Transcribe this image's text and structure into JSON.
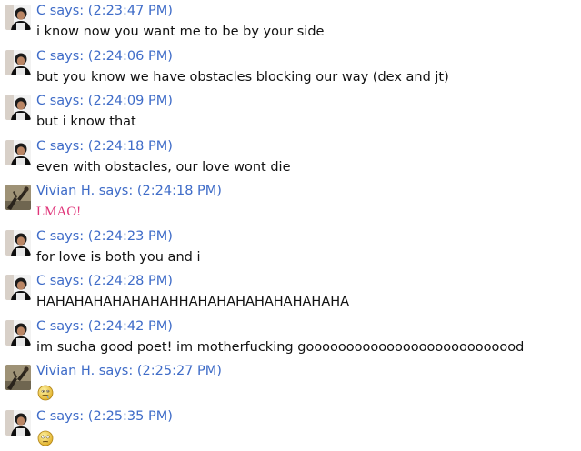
{
  "colors": {
    "sender": "#3f6cc8",
    "text": "#111111",
    "vivian_text": "#e0357a"
  },
  "messages": [
    {
      "sender": "C",
      "header": "C says: (2:23:47 PM)",
      "text": "i know now you want me to be by your side",
      "avatar": "c-avatar",
      "style": "default"
    },
    {
      "sender": "C",
      "header": "C says: (2:24:06 PM)",
      "text": "but you know we have obstacles blocking our way (dex and jt)",
      "avatar": "c-avatar",
      "style": "default"
    },
    {
      "sender": "C",
      "header": "C says: (2:24:09 PM)",
      "text": "but i know that",
      "avatar": "c-avatar",
      "style": "default"
    },
    {
      "sender": "C",
      "header": "C says: (2:24:18 PM)",
      "text": "even with obstacles, our love wont die",
      "avatar": "c-avatar",
      "style": "default"
    },
    {
      "sender": "Vivian H.",
      "header": "Vivian H. says: (2:24:18 PM)",
      "text": "LMAO!",
      "avatar": "vivian-avatar",
      "style": "vivian"
    },
    {
      "sender": "C",
      "header": "C says: (2:24:23 PM)",
      "text": "for love is both you and i",
      "avatar": "c-avatar",
      "style": "default"
    },
    {
      "sender": "C",
      "header": "C says: (2:24:28 PM)",
      "text": "HAHAHAHAHAHAHAHHAHAHAHAHAHAHAHAHA",
      "avatar": "c-avatar",
      "style": "default"
    },
    {
      "sender": "C",
      "header": "C says: (2:24:42 PM)",
      "text": "im sucha good poet! im motherfucking gooooooooooooooooooooooooood",
      "avatar": "c-avatar",
      "style": "default"
    },
    {
      "sender": "Vivian H.",
      "header": "Vivian H. says: (2:25:27 PM)",
      "text": "",
      "emoticon": "drooling-face-emoticon",
      "avatar": "vivian-avatar",
      "style": "vivian"
    },
    {
      "sender": "C",
      "header": "C says: (2:25:35 PM)",
      "text": "",
      "emoticon": "rolling-eyes-emoticon",
      "avatar": "c-avatar",
      "style": "default"
    }
  ]
}
